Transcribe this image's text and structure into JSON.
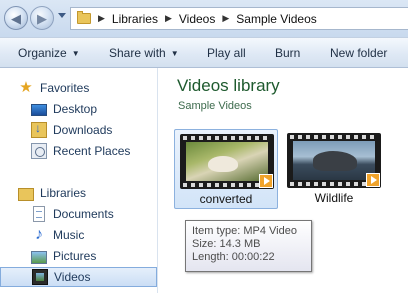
{
  "address_bar": {
    "breadcrumbs": [
      "Libraries",
      "Videos",
      "Sample Videos"
    ],
    "separator": "▶"
  },
  "command_bar": {
    "organize": "Organize",
    "share_with": "Share with",
    "play_all": "Play all",
    "burn": "Burn",
    "new_folder": "New folder",
    "dropdown_arrow": "▼"
  },
  "nav_pane": {
    "favorites": {
      "label": "Favorites",
      "items": [
        "Desktop",
        "Downloads",
        "Recent Places"
      ]
    },
    "libraries": {
      "label": "Libraries",
      "items": [
        "Documents",
        "Music",
        "Pictures",
        "Videos"
      ],
      "selected": "Videos"
    }
  },
  "content": {
    "title": "Videos library",
    "subtitle": "Sample Videos",
    "files": [
      {
        "name": "converted",
        "selected": true
      },
      {
        "name": "Wildlife",
        "selected": false
      }
    ]
  },
  "tooltip": {
    "item_type": "Item type: MP4 Video",
    "size": "Size: 14.3 MB",
    "length": "Length: 00:00:22"
  },
  "colors": {
    "library_title": "#1e5a2e",
    "nav_text": "#1e395b",
    "selection": "#cbdef5",
    "play_badge": "#f0a32b"
  },
  "icons": {
    "back": "back-arrow-icon",
    "forward": "forward-arrow-icon",
    "favorites": "star-icon",
    "desktop": "desktop-icon",
    "downloads": "downloads-folder-icon",
    "recent_places": "recent-places-icon",
    "libraries": "libraries-icon",
    "documents": "document-icon",
    "music": "music-note-icon",
    "pictures": "pictures-icon",
    "videos": "videos-icon"
  }
}
